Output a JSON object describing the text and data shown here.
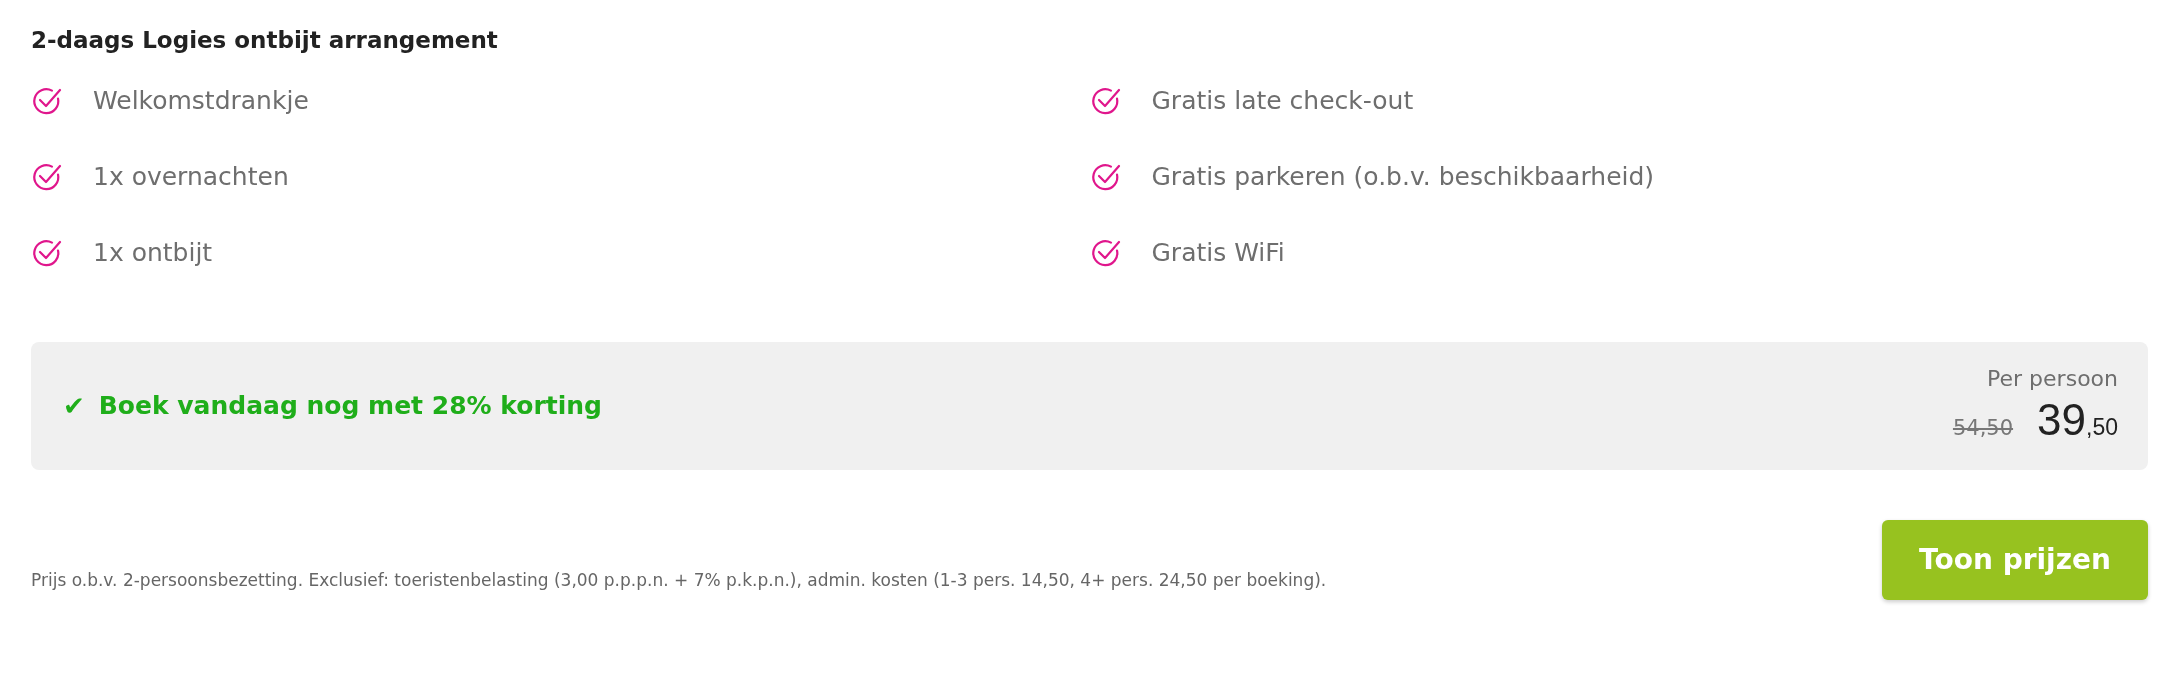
{
  "title": "2-daags Logies ontbijt arrangement",
  "features": [
    [
      "Welkomstdrankje",
      "1x overnachten",
      "1x ontbijt"
    ],
    [
      "Gratis late check-out",
      "Gratis parkeren (o.b.v. beschikbaarheid)",
      "Gratis WiFi"
    ]
  ],
  "promo": {
    "mark": "✔",
    "text": "Boek vandaag nog met 28% korting"
  },
  "price": {
    "label": "Per persoon",
    "old": "54,50",
    "main": "39",
    "cents": ",50"
  },
  "footnote": "Prijs o.b.v. 2-persoonsbezetting. Exclusief: toeristenbelasting (3,00 p.p.p.n. + 7% p.k.p.n.), admin. kosten (1-3 pers. 14,50, 4+ pers. 24,50 per boeking).",
  "button": "Toon prijzen"
}
